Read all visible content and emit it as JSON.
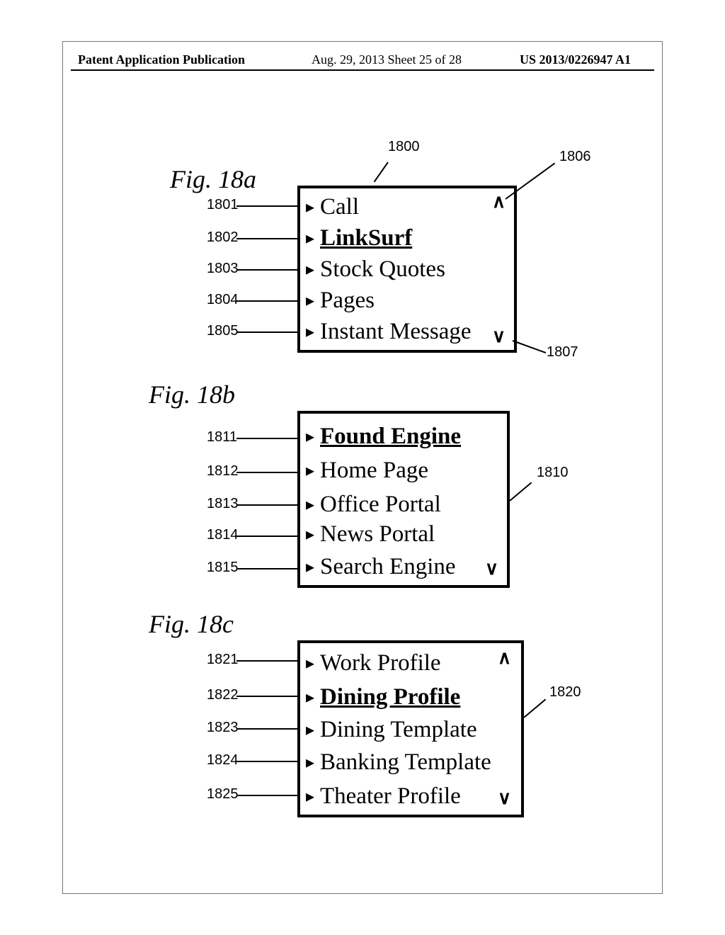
{
  "header": {
    "left": "Patent Application Publication",
    "center": "Aug. 29, 2013  Sheet 25 of 28",
    "right": "US 2013/0226947 A1"
  },
  "figures": {
    "a": {
      "title": "Fig. 18a",
      "box_ref": "1800",
      "up_ref": "1806",
      "down_ref": "1807",
      "items": [
        {
          "ref": "1801",
          "label": "Call",
          "selected": false
        },
        {
          "ref": "1802",
          "label": "LinkSurf",
          "selected": true
        },
        {
          "ref": "1803",
          "label": "Stock Quotes",
          "selected": false
        },
        {
          "ref": "1804",
          "label": "Pages",
          "selected": false
        },
        {
          "ref": "1805",
          "label": "Instant Message",
          "selected": false
        }
      ]
    },
    "b": {
      "title": "Fig. 18b",
      "box_ref": "1810",
      "items": [
        {
          "ref": "1811",
          "label": "Found Engine",
          "selected": true
        },
        {
          "ref": "1812",
          "label": "Home Page",
          "selected": false
        },
        {
          "ref": "1813",
          "label": "Office Portal",
          "selected": false
        },
        {
          "ref": "1814",
          "label": "News Portal",
          "selected": false
        },
        {
          "ref": "1815",
          "label": "Search Engine",
          "selected": false
        }
      ]
    },
    "c": {
      "title": "Fig. 18c",
      "box_ref": "1820",
      "items": [
        {
          "ref": "1821",
          "label": "Work Profile",
          "selected": false
        },
        {
          "ref": "1822",
          "label": "Dining Profile",
          "selected": true
        },
        {
          "ref": "1823",
          "label": "Dining Template",
          "selected": false
        },
        {
          "ref": "1824",
          "label": "Banking Template",
          "selected": false
        },
        {
          "ref": "1825",
          "label": "Theater Profile",
          "selected": false
        }
      ]
    }
  },
  "glyphs": {
    "arrow": "▸",
    "up": "∧",
    "down": "∨"
  }
}
